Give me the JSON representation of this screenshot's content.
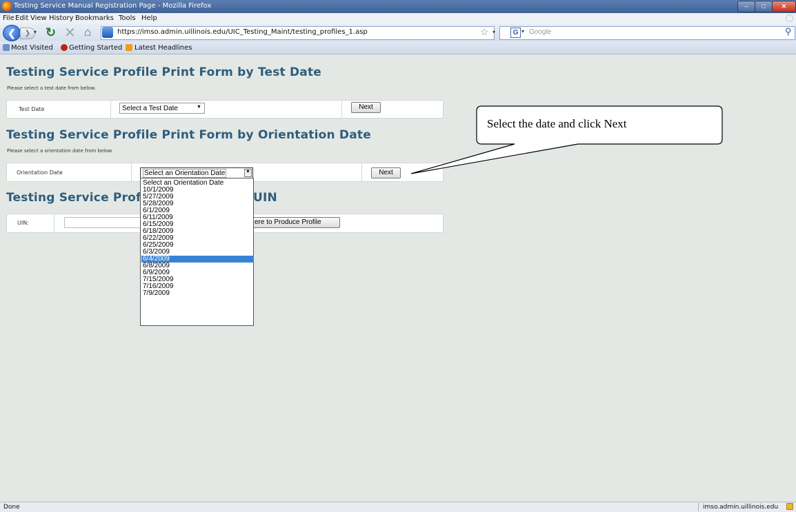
{
  "window": {
    "title": "Testing Service Manual Registration Page - Mozilla Firefox"
  },
  "menu": [
    "File",
    "Edit",
    "View",
    "History",
    "Bookmarks",
    "Tools",
    "Help"
  ],
  "nav": {
    "url": "https://imso.admin.uillinois.edu/UIC_Testing_Maint/testing_profiles_1.asp",
    "search_placeholder": "Google",
    "search_engine_letter": "G"
  },
  "bookmarks": [
    "Most Visited",
    "Getting Started",
    "Latest Headlines"
  ],
  "sections": {
    "test_date": {
      "heading": "Testing Service Profile Print Form by Test Date",
      "instructions": "Please select a test date from below.",
      "label": "Test Date",
      "select_value": "Select a Test Date",
      "button": "Next"
    },
    "orientation_date": {
      "heading": "Testing Service Profile Print Form by Orientation Date",
      "instructions": "Please select a orientation date from below.",
      "label": "Orientation Date",
      "select_value": "Select an Orientation Date",
      "button": "Next",
      "options": [
        "Select an Orientation Date",
        "10/1/2009",
        "5/27/2009",
        "5/28/2009",
        "6/1/2009",
        "6/11/2009",
        "6/15/2009",
        "6/18/2009",
        "6/22/2009",
        "6/25/2009",
        "6/3/2009",
        "6/4/2009",
        "6/8/2009",
        "6/9/2009",
        "7/15/2009",
        "7/16/2009",
        "7/9/2009"
      ],
      "highlighted_option": "6/4/2009"
    },
    "uin": {
      "heading_left": "Testing Service Prof",
      "heading_right": "UIN",
      "label": "UIN:",
      "input_value": "",
      "button_partial": "ere to Produce Profile"
    }
  },
  "callout": {
    "text": "Select the date and click Next"
  },
  "status": {
    "left": "Done",
    "right": "imso.admin.uillinois.edu"
  }
}
